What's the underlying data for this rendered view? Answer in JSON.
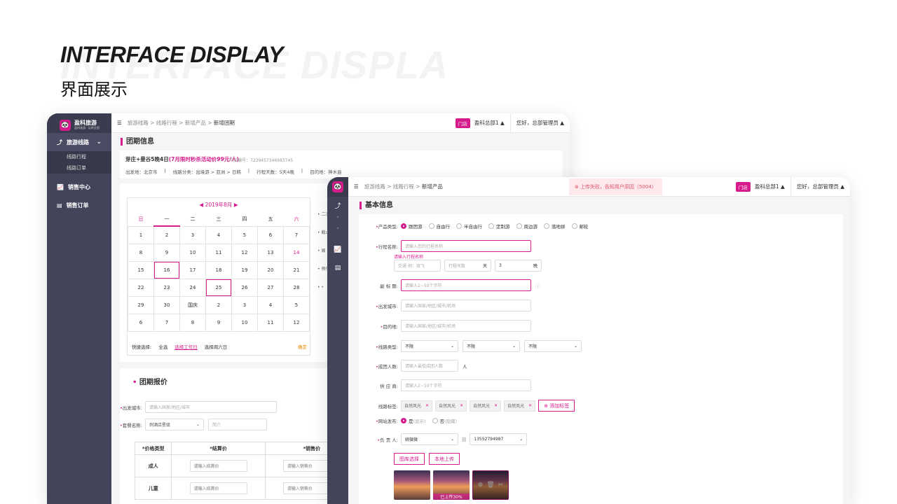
{
  "hero": {
    "title": "INTERFACE DISPLAY",
    "ghost": "INTERFACE DISPLA",
    "subtitle": "界面展示"
  },
  "win1": {
    "logo": {
      "title": "盈科旅游",
      "subtitle": "盈科旅游 · 玩转全国"
    },
    "nav": [
      {
        "label": "旅游线路"
      },
      {
        "label": "销售中心"
      },
      {
        "label": "销售订单"
      }
    ],
    "subnav": [
      "线路行程",
      "线路订单"
    ],
    "breadcrumb": {
      "path": "旅游线路 > 线路行程 > 新增产品 > ",
      "current": "新增团期"
    },
    "store_tag": "门店",
    "store": "盈科总部1 ▲",
    "user": "您好，总部管理员 ▲",
    "section1": "团期信息",
    "product": {
      "name": "芽庄+曼谷5晚4日",
      "promo": "(7月限时秒杀活动价99元/人)",
      "code": "产品编号：7239457346983745",
      "from": "出发地：北京市",
      "category": "线路分类：出境游 > 亚洲 > 日韩",
      "days": "行程天数：5天4晚",
      "dest": "目的地：神木县"
    },
    "calendar": {
      "month": "2019年8月",
      "weekdays": [
        "日",
        "一",
        "二",
        "三",
        "四",
        "五",
        "六"
      ],
      "rows": [
        [
          "1",
          "2",
          "3",
          "4",
          "5",
          "6",
          "7"
        ],
        [
          "8",
          "9",
          "10",
          "11",
          "12",
          "13",
          "14"
        ],
        [
          "15",
          "16",
          "17",
          "18",
          "19",
          "20",
          "21"
        ],
        [
          "22",
          "23",
          "24",
          "25",
          "26",
          "27",
          "28"
        ],
        [
          "29",
          "30",
          "国庆",
          "2",
          "3",
          "4",
          "5"
        ],
        [
          "6",
          "7",
          "8",
          "9",
          "10",
          "11",
          "12"
        ]
      ],
      "quick": "快捷选择:",
      "all": "全选",
      "workday": "选择工作日",
      "weekend": "选择周六日",
      "ok": "确定"
    },
    "side_labels": [
      "• 二次",
      "• 截止",
      "• 展",
      "• 预付",
      "• •"
    ],
    "section2": "团期报价",
    "form": {
      "city_label": "出发城市:",
      "city_ph": "请输入国家/地区/城市",
      "meal_label": "套餐名称:",
      "meal_val": "例酒店星级",
      "meal_ph": "简介"
    },
    "table": {
      "headers": [
        "*价格类型",
        "*结算价",
        "*销售价"
      ],
      "rows": [
        {
          "type": "成人",
          "p1": "请输入结算价",
          "p2": "请输入销售价"
        },
        {
          "type": "儿童",
          "p1": "请输入结算价",
          "p2": "请输入销售价"
        }
      ]
    }
  },
  "win2": {
    "breadcrumb": {
      "path": "旅游线路 > 线路行程 > ",
      "current": "新增产品"
    },
    "error": "上传失败，告知用户原因（5004）",
    "store_tag": "门店",
    "store": "盈科总部1 ▲",
    "user": "您好，总部管理员 ▲",
    "section": "基本信息",
    "type_label": "产品类型:",
    "types": [
      "跟团游",
      "自由行",
      "半自由行",
      "定制游",
      "周边游",
      "落地拼",
      "邮轮"
    ],
    "name_label": "行程名称:",
    "name_ph": "请输入您的行程名称",
    "name_err": "请输入行程名称",
    "traffic_ph": "交通 例：双飞",
    "days_ph": "行程天数",
    "days_unit": "天",
    "nights_val": "3",
    "nights_unit": "晚",
    "subtitle_label": "副 标 题:",
    "subtitle_ph": "请输入2~50个字符",
    "city_label": "出发城市:",
    "city_ph": "请输入国家/地区/城市/机场",
    "dest_label": "目的地:",
    "dest_ph": "请输入国家/地区/城市/机场",
    "cat_label": "线路类型:",
    "cat_vals": [
      "不限",
      "不限",
      "不限"
    ],
    "group_label": "成团人数:",
    "group_ph": "请输入最低成团人数",
    "group_unit": "人",
    "supplier_label": "供 应 商:",
    "supplier_ph": "请输入2~50个字符",
    "tags_label": "线路标签:",
    "tags": [
      "自然风光",
      "自然风光",
      "自然风光",
      "自然风光"
    ],
    "add_tag": "添加标签",
    "web_label": "网站发布:",
    "web_yes": "是",
    "web_yes_hint": "(显示)",
    "web_no": "否",
    "web_no_hint": "(隐藏)",
    "owner_label": "负 责 人:",
    "owner": "姚微微",
    "phone": "13552794987",
    "btn_gallery": "图库选择",
    "btn_upload": "本地上传",
    "upload_progress": "已上传30%"
  },
  "colors": {
    "accent": "#d61c8c",
    "sidebar": "#434459"
  }
}
